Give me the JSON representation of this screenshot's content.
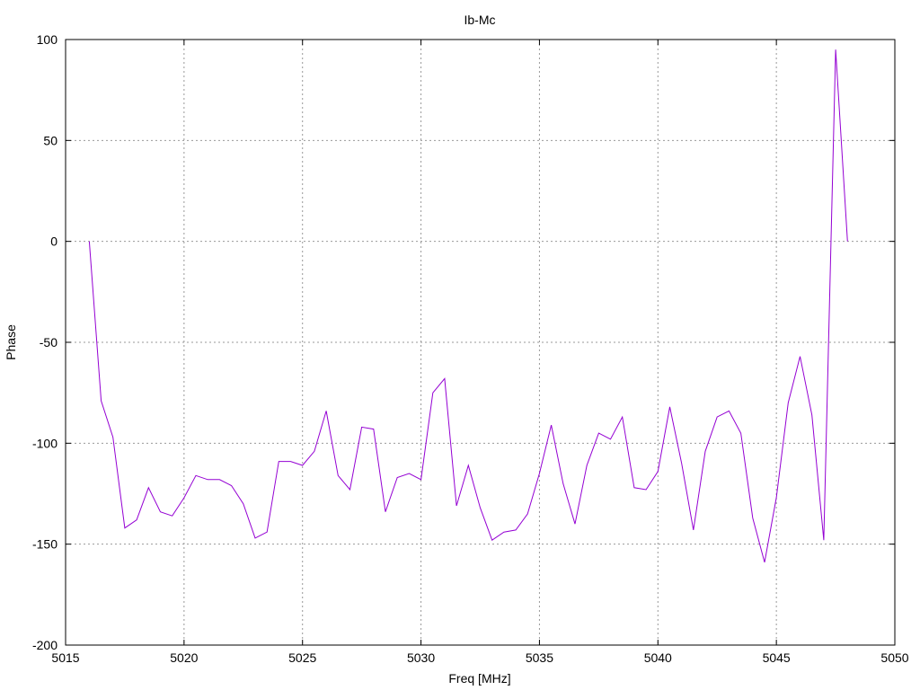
{
  "chart_data": {
    "type": "line",
    "title": "Ib-Mc",
    "xlabel": "Freq [MHz]",
    "ylabel": "Phase",
    "xlim": [
      5015,
      5050
    ],
    "ylim": [
      -200,
      100
    ],
    "xticks": [
      5015,
      5020,
      5025,
      5030,
      5035,
      5040,
      5045,
      5050
    ],
    "yticks": [
      -200,
      -150,
      -100,
      -50,
      0,
      50,
      100
    ],
    "grid": true,
    "series": [
      {
        "color": "#9400d3",
        "x": [
          5016,
          5016.5,
          5017,
          5017.5,
          5018,
          5018.5,
          5019,
          5019.5,
          5020,
          5020.5,
          5021,
          5021.5,
          5022,
          5022.5,
          5023,
          5023.5,
          5024,
          5024.5,
          5025,
          5025.5,
          5026,
          5026.5,
          5027,
          5027.5,
          5028,
          5028.5,
          5029,
          5029.5,
          5030,
          5030.5,
          5031,
          5031.5,
          5032,
          5032.5,
          5033,
          5033.5,
          5034,
          5034.5,
          5035,
          5035.5,
          5036,
          5036.5,
          5037,
          5037.5,
          5038,
          5038.5,
          5039,
          5039.5,
          5040,
          5040.5,
          5041,
          5041.5,
          5042,
          5042.5,
          5043,
          5043.5,
          5044,
          5044.5,
          5045,
          5045.5,
          5046,
          5046.5,
          5047,
          5047.5,
          5048
        ],
        "y": [
          0,
          -79,
          -97,
          -142,
          -138,
          -122,
          -134,
          -136,
          -127,
          -116,
          -118,
          -118,
          -121,
          -130,
          -147,
          -144,
          -109,
          -109,
          -111,
          -104,
          -84,
          -116,
          -123,
          -92,
          -93,
          -134,
          -117,
          -115,
          -118,
          -75,
          -68,
          -131,
          -111,
          -132,
          -148,
          -144,
          -143,
          -135,
          -115,
          -91,
          -120,
          -140,
          -111,
          -95,
          -98,
          -87,
          -122,
          -123,
          -114,
          -82,
          -110,
          -143,
          -104,
          -87,
          -84,
          -95,
          -137,
          -159,
          -127,
          -80,
          -57,
          -86,
          -148,
          95,
          0
        ]
      }
    ]
  }
}
